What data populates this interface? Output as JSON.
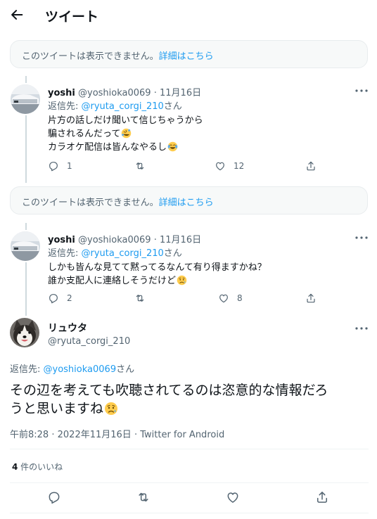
{
  "header": {
    "title": "ツイート"
  },
  "notices": [
    {
      "text": "このツイートは表示できません。",
      "link": "詳細はこちら"
    },
    {
      "text": "このツイートは表示できません。",
      "link": "詳細はこちら"
    }
  ],
  "tweets": [
    {
      "name": "yoshi",
      "handle": "@yoshioka0069",
      "sep": "·",
      "date": "11月16日",
      "reply_prefix": "返信先: ",
      "reply_user": "@ryuta_corgi_210",
      "reply_suffix": "さん",
      "lines": [
        "片方の話しだけ聞いて信じちゃうから",
        "騙されるんだって",
        "カラオケ配信は皆んなやるし"
      ],
      "line_emojis": [
        "",
        "rolling-on-floor-laughing",
        "face-with-tears-of-joy"
      ],
      "replies": "1",
      "likes": "12"
    },
    {
      "name": "yoshi",
      "handle": "@yoshioka0069",
      "sep": "·",
      "date": "11月16日",
      "reply_prefix": "返信先: ",
      "reply_user": "@ryuta_corgi_210",
      "reply_suffix": "さん",
      "lines": [
        "しかも皆んな見てて黙ってるなんて有り得ますかね？",
        "誰か支配人に連絡しそうだけど"
      ],
      "line_emojis": [
        "",
        "sad-but-relieved-face"
      ],
      "replies": "2",
      "likes": "8"
    }
  ],
  "main": {
    "name": "リュウタ",
    "handle": "@ryuta_corgi_210",
    "reply_prefix": "返信先: ",
    "reply_user": "@yoshioka0069",
    "reply_suffix": "さん",
    "text_line1": "その辺を考えても吹聴されてるのは恣意的な情報だろ",
    "text_line2": "うと思いますね",
    "text_emoji": "sad-but-relieved-face",
    "time": "午前8:28",
    "sep": "·",
    "date": "2022年11月16日",
    "sep2": "·",
    "source": "Twitter for Android",
    "like_count": "4",
    "like_label": " 件のいいね"
  },
  "icons": {
    "back": "arrow-left-icon",
    "more": "more-horizontal-icon",
    "reply": "reply-bubble-icon",
    "retweet": "retweet-icon",
    "like": "heart-icon",
    "share": "share-icon"
  },
  "colors": {
    "accent": "#1d9bf0",
    "secondary_text": "#536471",
    "notice_bg": "#f7f9f9"
  }
}
